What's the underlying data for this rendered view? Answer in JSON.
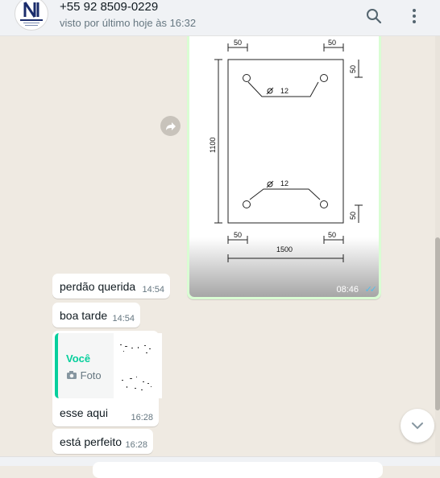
{
  "header": {
    "contact_name": "+55 92 8509-0229",
    "last_seen": "visto por último hoje às 16:32",
    "avatar_icon": "company-logo-avatar",
    "search_icon": "search-icon",
    "menu_icon": "kebab-menu-icon"
  },
  "messages": {
    "image": {
      "time": "08:46",
      "status_icon": "double-check-read-icon",
      "drawing": {
        "dim_top_left": "50",
        "dim_top_right": "50",
        "dim_bottom_left": "50",
        "dim_bottom_right": "50",
        "dim_right_top": "50",
        "dim_right_bottom": "50",
        "height_label": "1100",
        "width_label": "1500",
        "bar_top": "12",
        "bar_bottom": "12"
      }
    },
    "m1": {
      "text": "perdão querida",
      "time": "14:54"
    },
    "m2": {
      "text": "boa tarde",
      "time": "14:54"
    },
    "m3": {
      "quote_author": "Você",
      "quote_kind": "Foto",
      "text": "esse aqui",
      "time": "16:28"
    },
    "m4": {
      "text": "está perfeito",
      "time": "16:28"
    }
  },
  "colors": {
    "chat_bg": "#efeae2",
    "outgoing": "#d9fdd3",
    "quote_accent": "#06cf9c",
    "read_ticks": "#53bdeb"
  }
}
